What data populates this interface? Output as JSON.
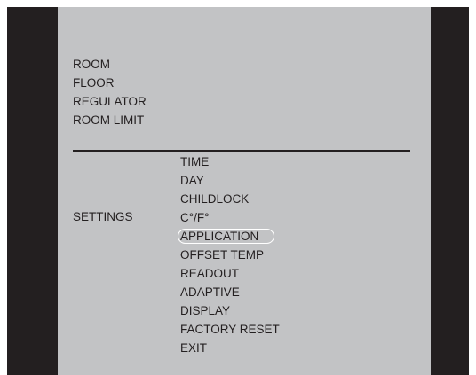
{
  "menu": {
    "top_items": [
      {
        "label": "ROOM"
      },
      {
        "label": "FLOOR"
      },
      {
        "label": "REGULATOR"
      },
      {
        "label": "ROOM LIMIT"
      }
    ],
    "settings_label": "SETTINGS",
    "settings_items": [
      {
        "label": "TIME"
      },
      {
        "label": "DAY"
      },
      {
        "label": "CHILDLOCK"
      },
      {
        "label": "C°/F°"
      },
      {
        "label": "APPLICATION"
      },
      {
        "label": "OFFSET TEMP"
      },
      {
        "label": "READOUT"
      },
      {
        "label": "ADAPTIVE"
      },
      {
        "label": "DISPLAY"
      },
      {
        "label": "FACTORY RESET"
      },
      {
        "label": "EXIT"
      }
    ],
    "selected_item": "APPLICATION"
  },
  "colors": {
    "bezel": "#231f20",
    "screen": "#c2c3c5",
    "text": "#231f20",
    "highlight_outline": "#ffffff"
  }
}
